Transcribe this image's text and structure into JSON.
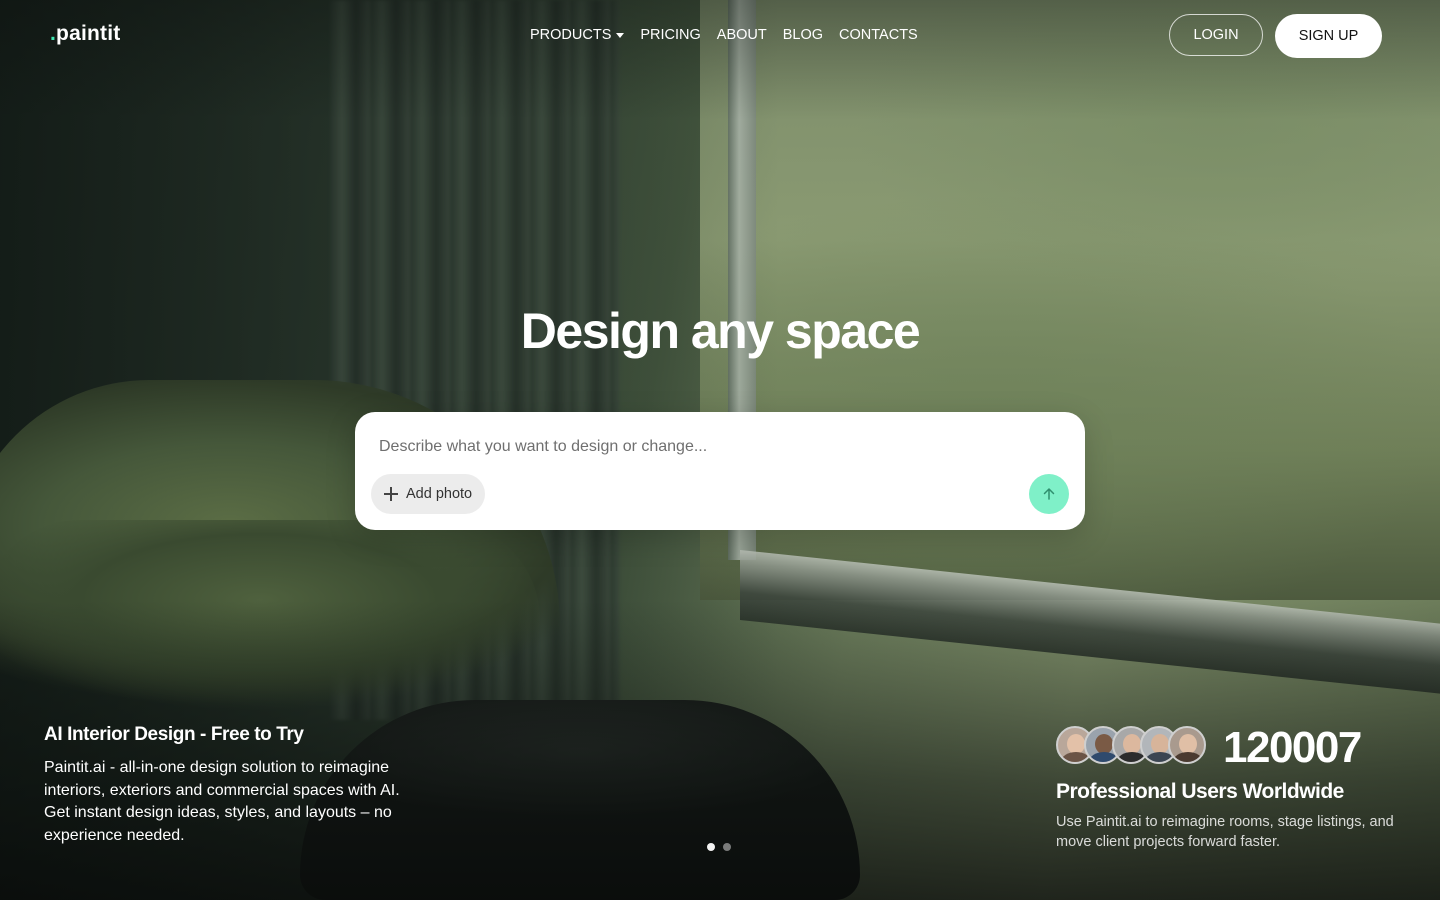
{
  "brand": {
    "logo_dot": ".",
    "logo_text": "paintit",
    "accent_color": "#3ee6b0"
  },
  "nav": {
    "items": [
      {
        "label": "PRODUCTS",
        "has_dropdown": true
      },
      {
        "label": "PRICING"
      },
      {
        "label": "ABOUT"
      },
      {
        "label": "BLOG"
      },
      {
        "label": "CONTACTS"
      }
    ]
  },
  "auth": {
    "login_label": "LOGIN",
    "signup_label": "SIGN UP"
  },
  "hero": {
    "headline": "Design any space",
    "prompt": {
      "placeholder": "Describe what you want to design or change...",
      "value": "",
      "add_photo_label": "Add photo",
      "send_icon": "arrow-up-icon",
      "send_color": "#7ff0c8"
    }
  },
  "info": {
    "title": "AI Interior Design - Free to Try",
    "description": "Paintit.ai - all-in-one design solution to reimagine interiors, exteriors and commercial spaces with AI. Get instant design ideas, styles, and layouts – no experience needed."
  },
  "carousel": {
    "total": 2,
    "active_index": 0
  },
  "stats": {
    "avatar_count": 5,
    "number": "120007",
    "label": "Professional Users Worldwide",
    "description": "Use Paintit.ai to reimagine rooms, stage listings, and move client projects forward faster."
  }
}
